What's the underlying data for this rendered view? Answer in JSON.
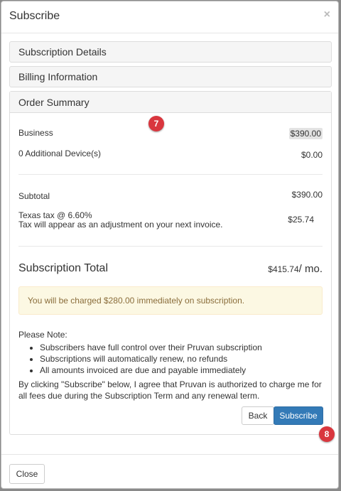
{
  "modal": {
    "title": "Subscribe",
    "close_glyph": "×"
  },
  "panels": {
    "subscription_details": "Subscription Details",
    "billing_information": "Billing Information",
    "order_summary": "Order Summary"
  },
  "summary": {
    "business_label": "Business",
    "business_value": "$390.00",
    "devices_label": "0 Additional Device(s)",
    "devices_value": "$0.00",
    "subtotal_label": "Subtotal",
    "subtotal_value": "$390.00",
    "tax_label": "Texas tax @ 6.60%",
    "tax_note": "Tax will appear as an adjustment on your next invoice.",
    "tax_value": "$25.74",
    "total_label": "Subscription Total",
    "total_value": "$415.74",
    "total_unit": "/ mo."
  },
  "alert": "You will be charged $280.00 immediately on subscription.",
  "note": {
    "heading": "Please Note:",
    "items": [
      "Subscribers have full control over their Pruvan subscription",
      "Subscriptions will automatically renew, no refunds",
      "All amounts invoiced are due and payable immediately"
    ]
  },
  "agreement": "By clicking \"Subscribe\" below, I agree that Pruvan is authorized to charge me for all fees due during the Subscription Term and any renewal term.",
  "buttons": {
    "back": "Back",
    "subscribe": "Subscribe",
    "close": "Close"
  },
  "badges": {
    "step7": "7",
    "step8": "8"
  },
  "colors": {
    "primary": "#337ab7",
    "alert_bg": "#fcf8e3",
    "badge": "#d9363e"
  }
}
